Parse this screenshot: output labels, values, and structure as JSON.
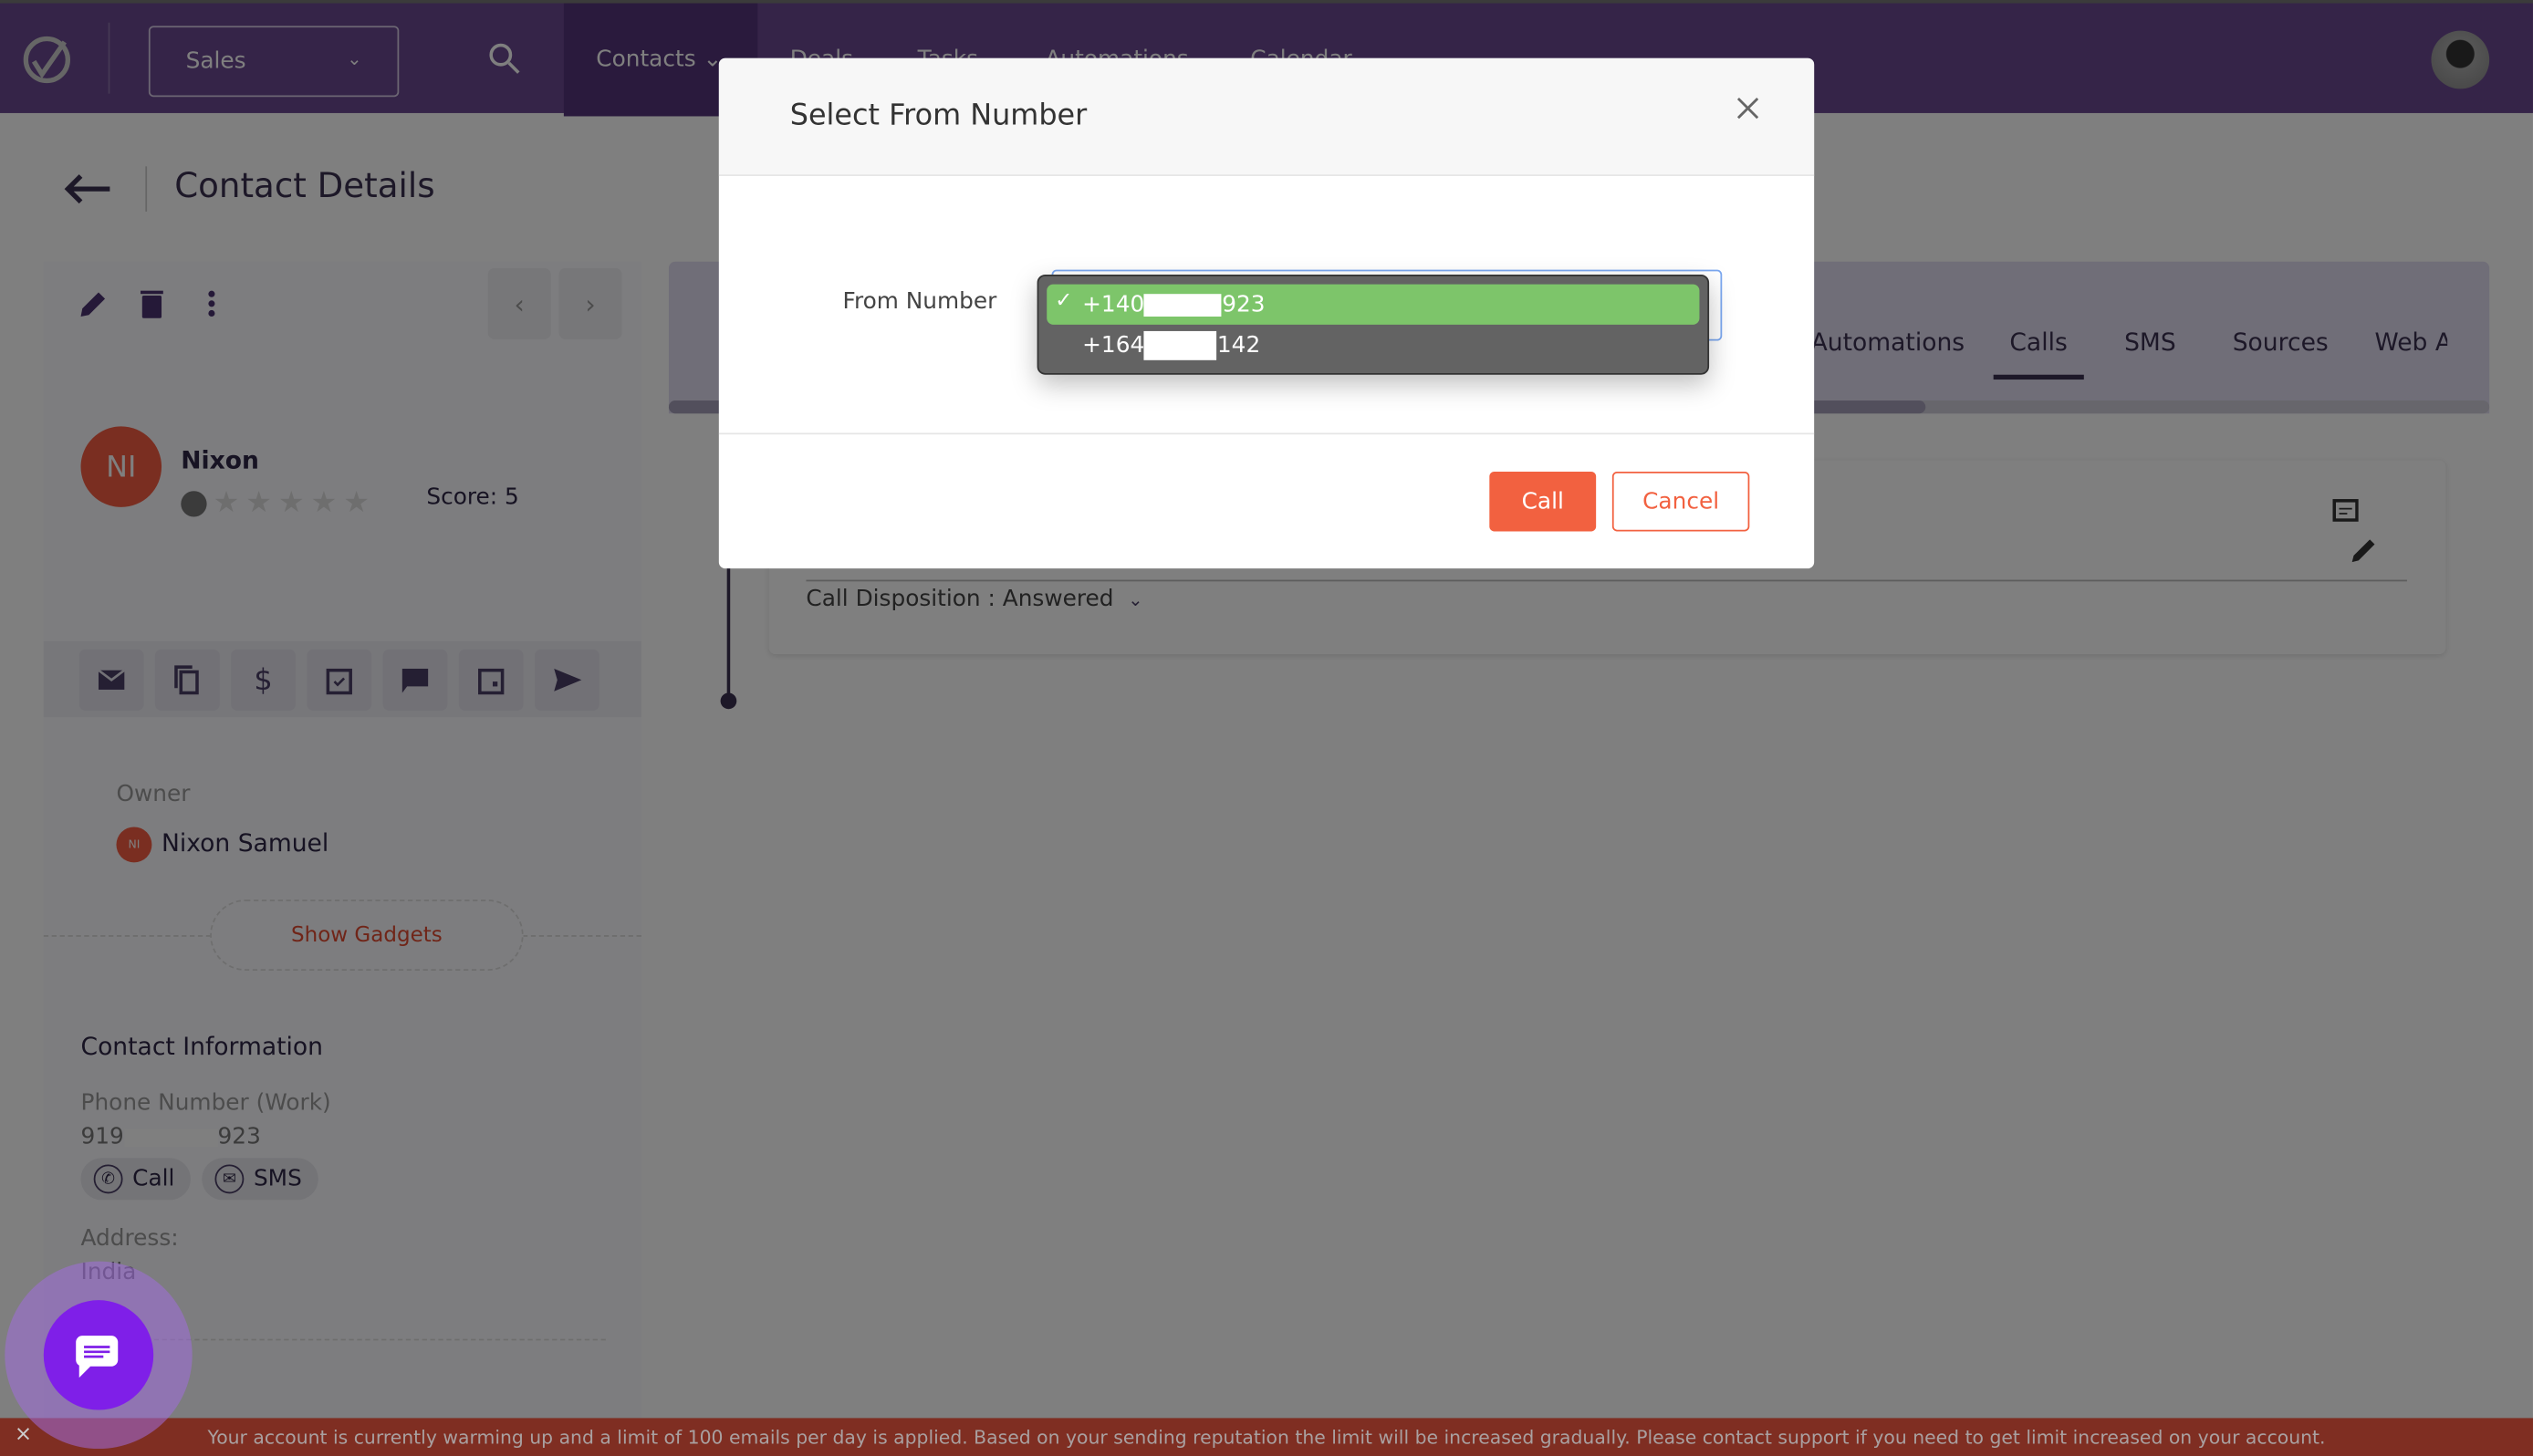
{
  "topbar": {
    "workspace": "Sales",
    "nav": [
      "Contacts",
      "Deals",
      "Tasks",
      "Automations",
      "Calendar",
      "..."
    ],
    "active_nav": "Contacts"
  },
  "page": {
    "title": "Contact Details"
  },
  "contact": {
    "initials": "NI",
    "name": "Nixon",
    "score_label": "Score: 5",
    "rating": 0,
    "owner_label": "Owner",
    "owner_name": "Nixon Samuel",
    "owner_initials": "NI",
    "show_gadgets": "Show Gadgets",
    "info_heading": "Contact Information",
    "phone_label": "Phone Number (Work)",
    "phone_prefix": "919",
    "phone_suffix": "923",
    "call_chip": "Call",
    "sms_chip": "SMS",
    "address_label": "Address:",
    "address_value": "India"
  },
  "tabs": [
    "Automations",
    "Calls",
    "SMS",
    "Sources",
    "Web A"
  ],
  "active_tab": "Calls",
  "call_card": {
    "disposition": "Call Disposition : Answered"
  },
  "dialog": {
    "title": "Select From Number",
    "field_label": "From Number",
    "options": [
      {
        "prefix": "+140",
        "suffix": "923",
        "selected": true
      },
      {
        "prefix": "+164",
        "suffix": "142",
        "selected": false
      }
    ],
    "call_button": "Call",
    "cancel_button": "Cancel"
  },
  "banner": {
    "message": "Your account is currently warming up and a limit of 100 emails per day is applied. Based on your sending reputation the limit will be increased gradually. Please contact support if you need to get limit increased on your account.",
    "close": "×"
  },
  "colors": {
    "brand": "#6a4890",
    "accent": "#f26140",
    "selected_option": "#7dc56a",
    "chat": "#7f1fe8"
  }
}
